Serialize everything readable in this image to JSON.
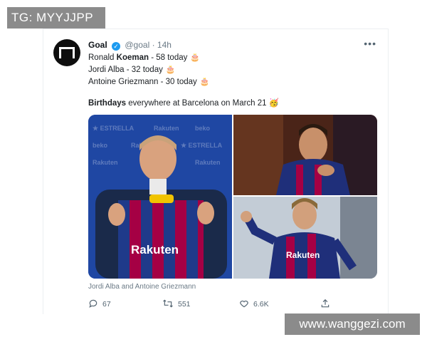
{
  "watermarks": {
    "top_left": "TG: MYYJJPP",
    "bottom_right": "www.wanggezi.com"
  },
  "tweet": {
    "author_name": "Goal",
    "handle": "@goal",
    "separator": "·",
    "time": "14h",
    "more_label": "•••",
    "lines": [
      {
        "prefix": "Ronald ",
        "bold": "Koeman",
        "suffix": " - 58 today"
      },
      {
        "prefix": "Jordi Alba - 32 today",
        "bold": "",
        "suffix": ""
      },
      {
        "prefix": "Antoine Griezmann - 30 today",
        "bold": "",
        "suffix": ""
      }
    ],
    "birthday_bold": "Birthdays",
    "birthday_rest": " everywhere at Barcelona on March 21",
    "cake_icon": "🎂",
    "party_emoji": "🥳",
    "media_caption": "Jordi Alba and Antoine Griezmann",
    "actions": {
      "replies": "67",
      "retweets": "551",
      "likes": "6.6K"
    }
  },
  "colors": {
    "verified": "#1d9bf0",
    "barca_blue": "#1f4aa8",
    "barca_red": "#a50044"
  }
}
